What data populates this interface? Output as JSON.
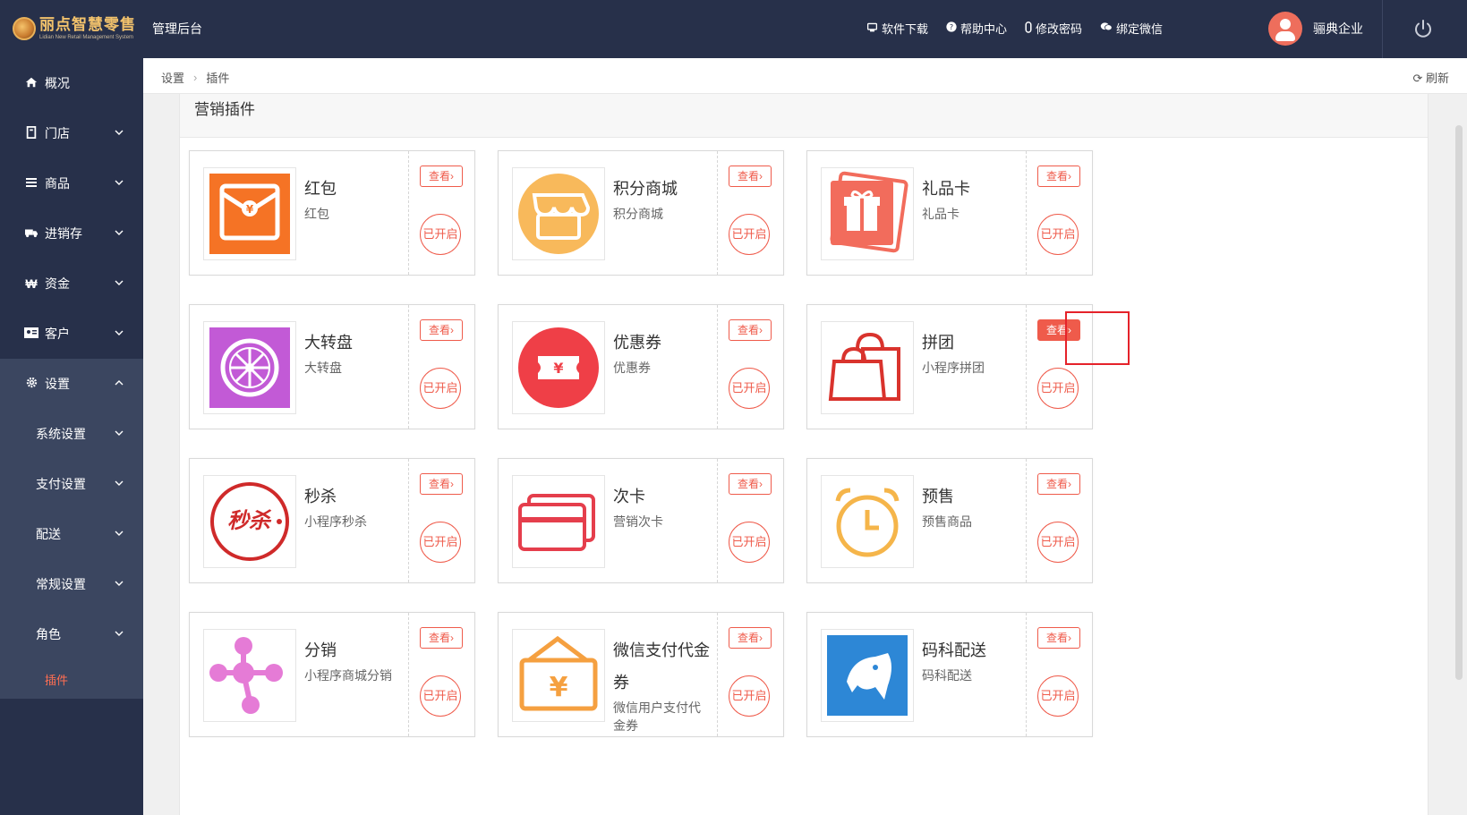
{
  "header": {
    "logo_title": "丽点智慧零售",
    "logo_subtitle": "Lidian New Retail Management System",
    "admin_title": "管理后台",
    "actions": [
      {
        "label": "软件下载",
        "icon": "download-icon"
      },
      {
        "label": "帮助中心",
        "icon": "help-icon"
      },
      {
        "label": "修改密码",
        "icon": "lock-icon"
      },
      {
        "label": "绑定微信",
        "icon": "wechat-icon"
      }
    ],
    "user_name": "骊典企业"
  },
  "sidebar": {
    "items": [
      {
        "label": "概况",
        "icon": "home-icon"
      },
      {
        "label": "门店",
        "icon": "store-icon"
      },
      {
        "label": "商品",
        "icon": "list-icon"
      },
      {
        "label": "进销存",
        "icon": "truck-icon"
      },
      {
        "label": "资金",
        "icon": "currency-icon"
      },
      {
        "label": "客户",
        "icon": "id-card-icon"
      },
      {
        "label": "设置",
        "icon": "gear-icon"
      }
    ],
    "sub_items": [
      {
        "label": "系统设置"
      },
      {
        "label": "支付设置"
      },
      {
        "label": "配送"
      },
      {
        "label": "常规设置"
      },
      {
        "label": "角色"
      },
      {
        "label": "插件"
      }
    ]
  },
  "breadcrumb": {
    "items": [
      "设置",
      "插件"
    ],
    "refresh_label": "刷新"
  },
  "section": {
    "title": "营销插件"
  },
  "plugin_buttons": {
    "view_label": "查看",
    "status_label": "已开启"
  },
  "plugins": [
    {
      "title": "红包",
      "desc": "红包",
      "icon": "red-envelope-icon"
    },
    {
      "title": "积分商城",
      "desc": "积分商城",
      "icon": "shop-icon"
    },
    {
      "title": "礼品卡",
      "desc": "礼品卡",
      "icon": "gift-card-icon"
    },
    {
      "title": "大转盘",
      "desc": "大转盘",
      "icon": "wheel-icon"
    },
    {
      "title": "优惠券",
      "desc": "优惠券",
      "icon": "coupon-icon"
    },
    {
      "title": "拼团",
      "desc": "小程序拼团",
      "icon": "shopping-bag-icon"
    },
    {
      "title": "秒杀",
      "desc": "小程序秒杀",
      "icon": "flash-sale-icon",
      "badge_text": "秒杀"
    },
    {
      "title": "次卡",
      "desc": "营销次卡",
      "icon": "cards-icon"
    },
    {
      "title": "预售",
      "desc": "预售商品",
      "icon": "alarm-clock-icon"
    },
    {
      "title": "分销",
      "desc": "小程序商城分销",
      "icon": "share-network-icon"
    },
    {
      "title": "微信支付代金券",
      "desc": "微信用户支付代金券",
      "icon": "wallet-icon"
    },
    {
      "title": "码科配送",
      "desc": "码科配送",
      "icon": "horse-logo-icon"
    }
  ]
}
